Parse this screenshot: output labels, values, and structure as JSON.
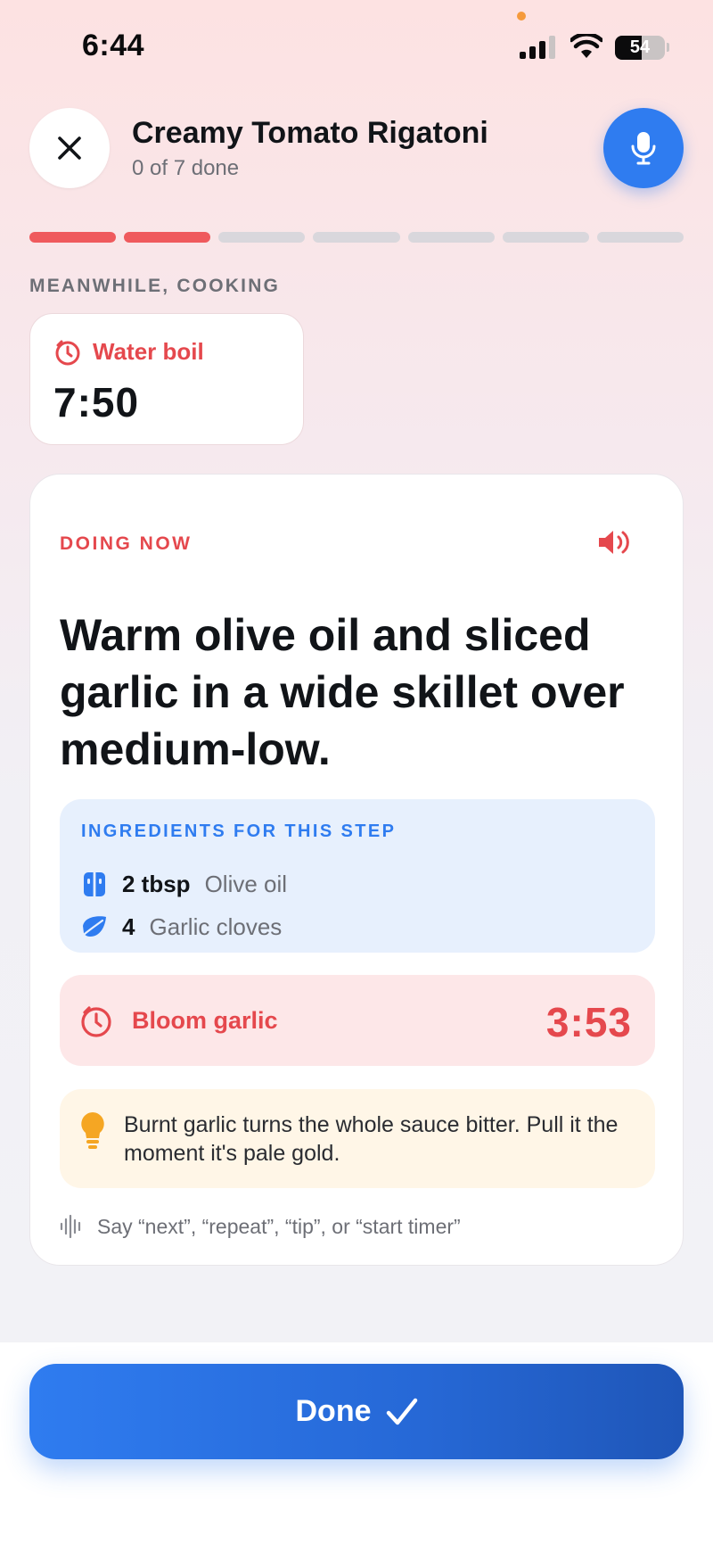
{
  "status_bar": {
    "time": "6:44",
    "battery": "54",
    "battery_level": 0.54
  },
  "header": {
    "title": "Creamy Tomato Rigatoni",
    "subtitle": "0 of 7 done"
  },
  "progress": {
    "total_steps": 7,
    "highlighted_segments": 2
  },
  "meanwhile": {
    "section_label": "MEANWHILE, COOKING",
    "timers": [
      {
        "label": "Water boil",
        "value": "7:50"
      }
    ]
  },
  "current_step": {
    "label": "DOING NOW",
    "instruction": "Warm olive oil and sliced garlic in a wide skillet over medium-low.",
    "ingredients_title": "INGREDIENTS FOR THIS STEP",
    "ingredients": [
      {
        "qty": "2 tbsp",
        "name": "Olive oil",
        "icon": "bottle-icon"
      },
      {
        "qty": "4",
        "name": "Garlic cloves",
        "icon": "leaf-icon"
      }
    ],
    "timer": {
      "label": "Bloom garlic",
      "value": "3:53"
    },
    "tip": "Burnt garlic turns the whole sauce bitter. Pull it the moment it's pale gold.",
    "voice_hint": "Say “next”, “repeat”, “tip”, or “start timer”"
  },
  "footer": {
    "done_label": "Done"
  },
  "colors": {
    "accent_red": "#e5484d",
    "accent_blue": "#2f7cf0",
    "tip_bg": "#fff6e7"
  }
}
